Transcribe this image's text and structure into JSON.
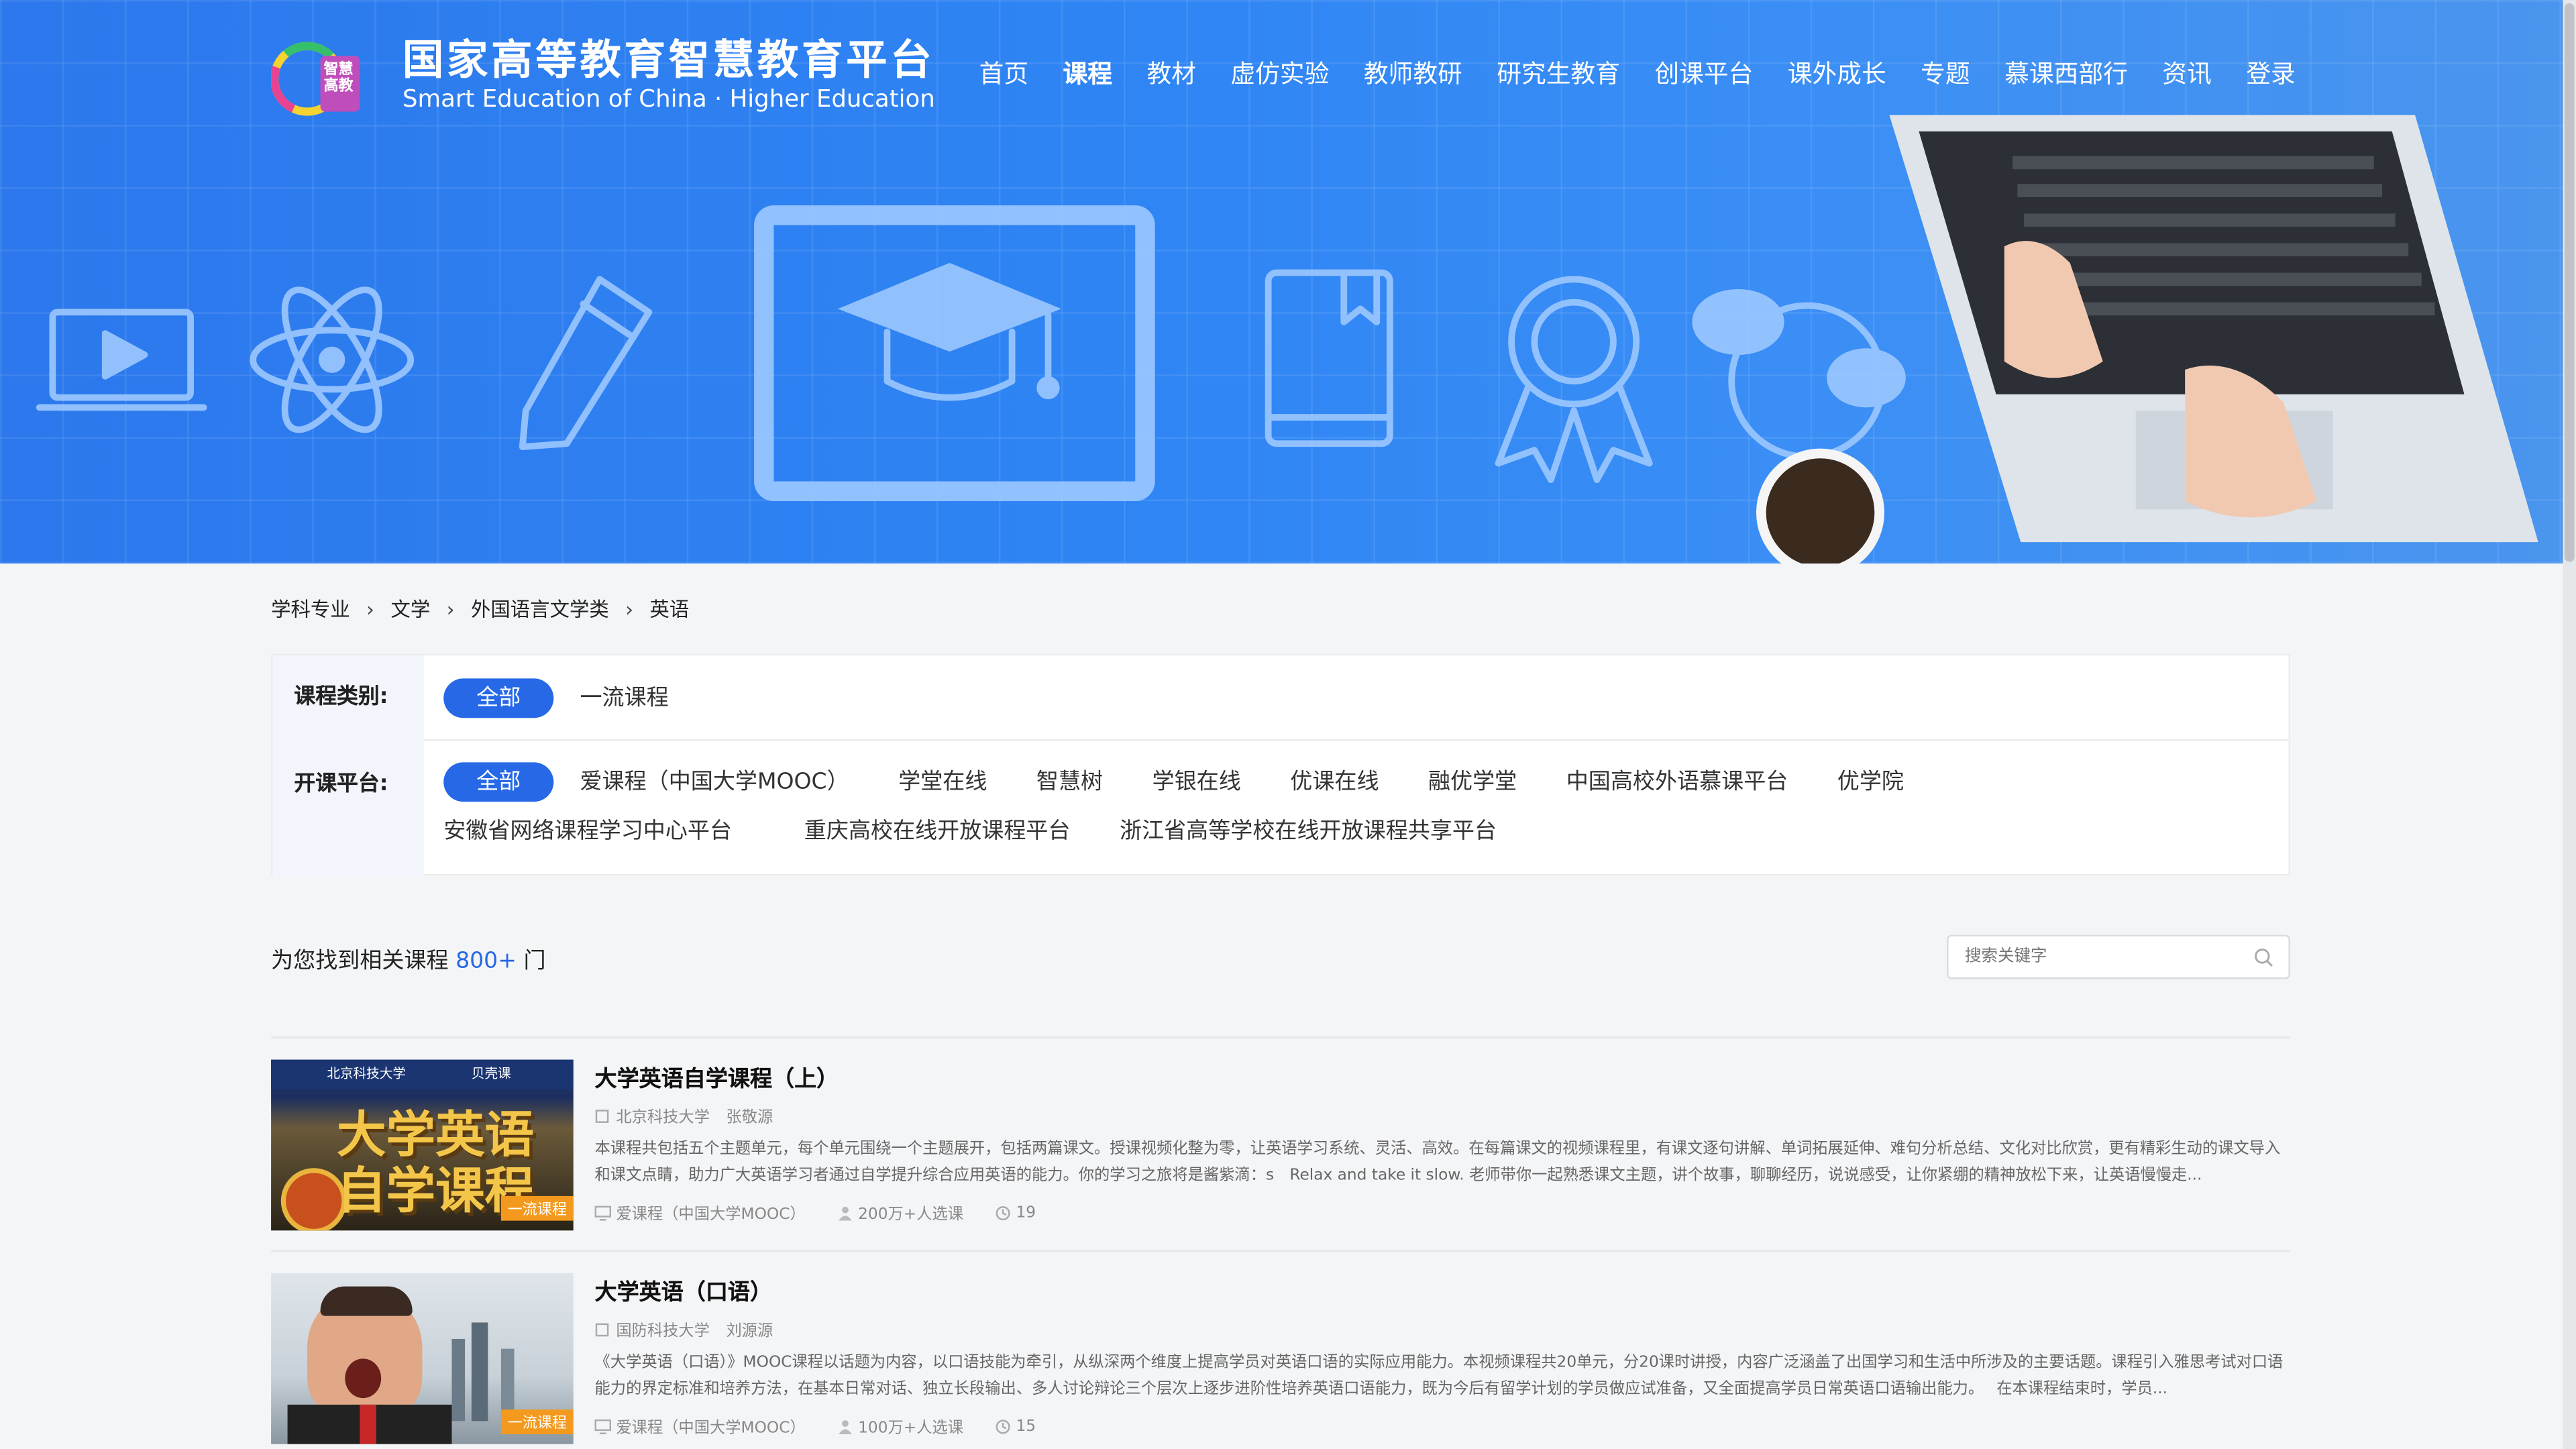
{
  "logo": {
    "cn": "国家高等教育智慧教育平台",
    "en": "Smart Education of China · Higher Education",
    "badge": "智慧高教"
  },
  "nav": [
    "首页",
    "课程",
    "教材",
    "虚仿实验",
    "教师教研",
    "研究生教育",
    "创课平台",
    "课外成长",
    "专题",
    "慕课西部行",
    "资讯",
    "登录"
  ],
  "nav_active": "课程",
  "breadcrumb": [
    "学科专业",
    "文学",
    "外国语言文学类",
    "英语"
  ],
  "filter": {
    "category_label": "课程类别:",
    "categories": [
      "全部",
      "一流课程"
    ],
    "platform_label": "开课平台:",
    "platforms": [
      "全部",
      "爱课程（中国大学MOOC）",
      "学堂在线",
      "智慧树",
      "学银在线",
      "优课在线",
      "融优学堂",
      "中国高校外语慕课平台",
      "优学院",
      "安徽省网络课程学习中心平台",
      "重庆高校在线开放课程平台",
      "浙江省高等学校在线开放课程共享平台"
    ]
  },
  "results": {
    "prefix": "为您找到相关课程",
    "count": "800+",
    "suffix": "门"
  },
  "search": {
    "placeholder": "搜索关键字"
  },
  "courses": [
    {
      "title": "大学英语自学课程（上）",
      "school": "北京科技大学",
      "teacher": "张敬源",
      "badge": "一流课程",
      "thumb_top_left": "北京科技大学",
      "thumb_top_right": "贝壳课",
      "thumb_caption": "大学英语自学课程",
      "desc": "本课程共包括五个主题单元，每个单元围绕一个主题展开，包括两篇课文。授课视频化整为零，让英语学习系统、灵活、高效。在每篇课文的视频课程里，有课文逐句讲解、单词拓展延伸、难句分析总结、文化对比欣赏，更有精彩生动的课文导入和课文点睛，助力广大英语学习者通过自学提升综合应用英语的能力。你的学习之旅将是酱紫滴：s　Relax and take it slow. 老师带你一起熟悉课文主题，讲个故事，聊聊经历，说说感受，让你紧绷的精神放松下来，让英语慢慢走...",
      "platform": "爱课程（中国大学MOOC）",
      "learners": "200万+人选课",
      "sessions": "19"
    },
    {
      "title": "大学英语（口语）",
      "school": "国防科技大学",
      "teacher": "刘源源",
      "badge": "一流课程",
      "desc": "《大学英语（口语）》MOOC课程以话题为内容，以口语技能为牵引，从纵深两个维度上提高学员对英语口语的实际应用能力。本视频课程共20单元，分20课时讲授，内容广泛涵盖了出国学习和生活中所涉及的主要话题。课程引入雅思考试对口语能力的界定标准和培养方法，在基本日常对话、独立长段输出、多人讨论辩论三个层次上逐步进阶性培养英语口语能力，既为今后有留学计划的学员做应试准备，又全面提高学员日常英语口语输出能力。　 在本课程结束时，学员...",
      "platform": "爱课程（中国大学MOOC）",
      "learners": "100万+人选课",
      "sessions": "15"
    }
  ],
  "colors": {
    "hero": "#2f85f4",
    "accent": "#2668e6",
    "badge": "#f39a1e"
  }
}
